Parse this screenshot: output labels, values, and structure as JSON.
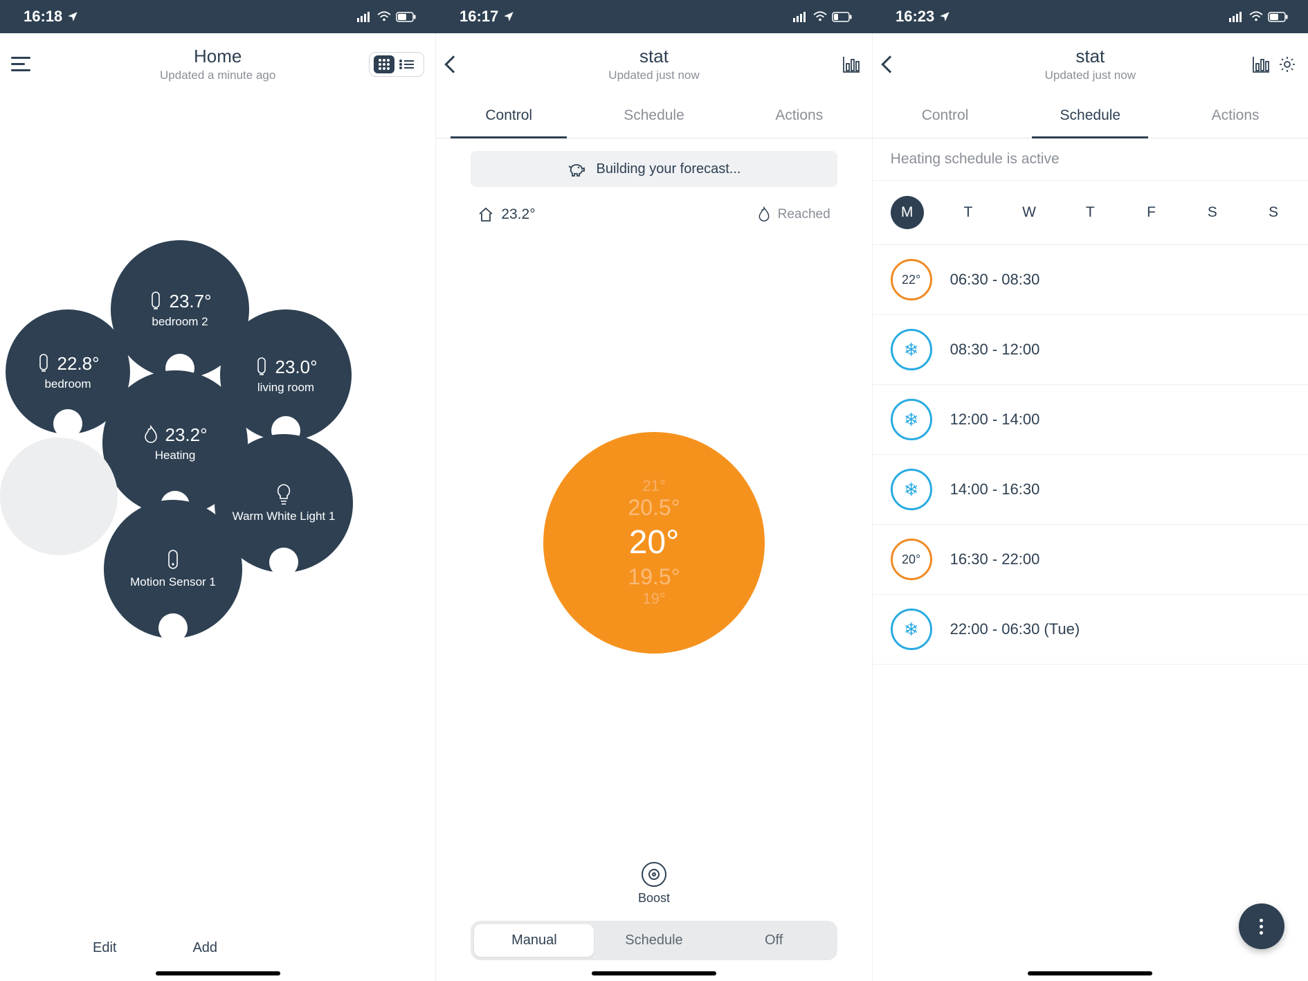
{
  "status_bars": [
    {
      "time": "16:18"
    },
    {
      "time": "16:17"
    },
    {
      "time": "16:23"
    }
  ],
  "panel1": {
    "title": "Home",
    "subtitle": "Updated a minute ago",
    "bubbles": {
      "bedroom": {
        "temp": "22.8°",
        "label": "bedroom"
      },
      "bedroom2": {
        "temp": "23.7°",
        "label": "bedroom 2"
      },
      "living": {
        "temp": "23.0°",
        "label": "living room"
      },
      "heating": {
        "temp": "23.2°",
        "label": "Heating"
      },
      "light": {
        "label": "Warm White Light 1"
      },
      "motion": {
        "label": "Motion Sensor 1"
      }
    },
    "footer": {
      "edit": "Edit",
      "add": "Add"
    }
  },
  "panel2": {
    "title": "stat",
    "subtitle": "Updated just now",
    "tabs": {
      "control": "Control",
      "schedule": "Schedule",
      "actions": "Actions",
      "active": "Control"
    },
    "forecast_text": "Building your forecast...",
    "home_temp": "23.2°",
    "reached_label": "Reached",
    "dial": {
      "above2": "21°",
      "above": "20.5°",
      "main": "20°",
      "below": "19.5°",
      "below2": "19°"
    },
    "boost_label": "Boost",
    "modes": {
      "manual": "Manual",
      "schedule": "Schedule",
      "off": "Off",
      "active": "Manual"
    }
  },
  "panel3": {
    "title": "stat",
    "subtitle": "Updated just now",
    "tabs": {
      "control": "Control",
      "schedule": "Schedule",
      "actions": "Actions",
      "active": "Schedule"
    },
    "status_text": "Heating schedule is active",
    "days": [
      "M",
      "T",
      "W",
      "T",
      "F",
      "S",
      "S"
    ],
    "active_day_index": 0,
    "items": [
      {
        "type": "heat",
        "temp": "22°",
        "range": "06:30 - 08:30"
      },
      {
        "type": "cool",
        "range": "08:30 - 12:00"
      },
      {
        "type": "cool",
        "range": "12:00 - 14:00"
      },
      {
        "type": "cool",
        "range": "14:00 - 16:30"
      },
      {
        "type": "heat",
        "temp": "20°",
        "range": "16:30 - 22:00"
      },
      {
        "type": "cool",
        "range": "22:00 - 06:30 (Tue)"
      }
    ]
  }
}
